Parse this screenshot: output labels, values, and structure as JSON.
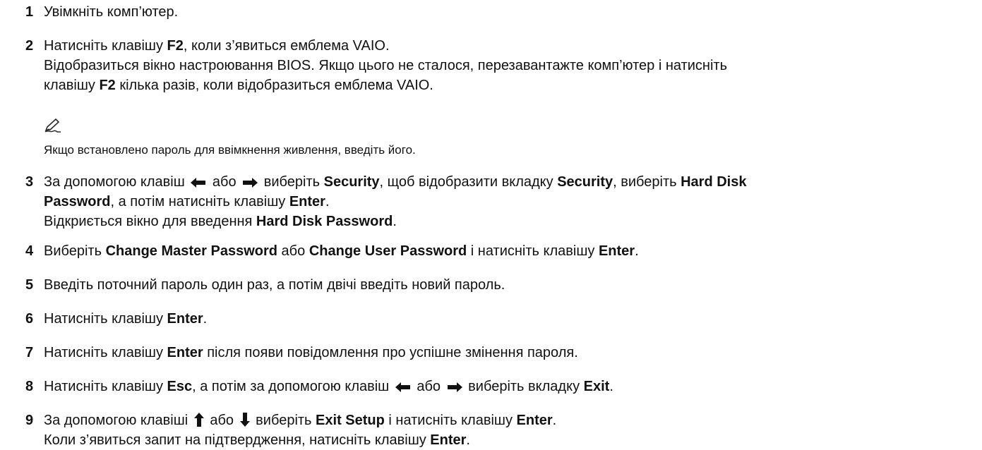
{
  "steps": [
    {
      "num": "1",
      "lines": [
        {
          "t": "Увімкніть комп’ютер."
        }
      ]
    },
    {
      "num": "2",
      "lines": [
        {
          "pre": "Натисніть клавішу ",
          "b1": "F2",
          "post": ", коли з’явиться емблема VAIO."
        },
        {
          "t": "Відобразиться вікно настроювання BIOS. Якщо цього не сталося, перезавантажте комп’ютер і натисніть"
        },
        {
          "pre": "клавішу ",
          "b1": "F2",
          "post": " кілька разів, коли відобразиться емблема VAIO."
        }
      ]
    },
    {
      "num": "3",
      "line1": {
        "pre": "За допомогою клавіш ",
        "mid1": " або ",
        "mid2": " виберіть ",
        "b1": "Security",
        "mid3": ", щоб відобразити вкладку ",
        "b2": "Security",
        "mid4": ", виберіть ",
        "b3": "Hard Disk"
      },
      "line2": {
        "b1": "Password",
        "mid": ", а потім натисніть клавішу ",
        "b2": "Enter",
        "post": "."
      },
      "line3": {
        "pre": "Відкриється вікно для введення ",
        "b1": "Hard Disk Password",
        "post": "."
      }
    },
    {
      "num": "4",
      "line1": {
        "pre": "Виберіть ",
        "b1": "Change Master Password",
        "mid": " або ",
        "b2": "Change User Password",
        "mid2": " і натисніть клавішу ",
        "b3": "Enter",
        "post": "."
      }
    },
    {
      "num": "5",
      "lines": [
        {
          "t": "Введіть поточний пароль один раз, а потім двічі введіть новий пароль."
        }
      ]
    },
    {
      "num": "6",
      "line1": {
        "pre": "Натисніть клавішу ",
        "b1": "Enter",
        "post": "."
      }
    },
    {
      "num": "7",
      "line1": {
        "pre": "Натисніть клавішу ",
        "b1": "Enter",
        "post": " після появи повідомлення про успішне змінення пароля."
      }
    },
    {
      "num": "8",
      "line1": {
        "pre": "Натисніть клавішу ",
        "b1": "Esc",
        "mid": ", а потім за допомогою клавіш ",
        "mid2": " або ",
        "mid3": " виберіть вкладку ",
        "b2": "Exit",
        "post": "."
      }
    },
    {
      "num": "9",
      "line1": {
        "pre": "За допомогою клавіші ",
        "mid": " або ",
        "mid2": " виберіть ",
        "b1": "Exit Setup",
        "mid3": " і натисніть клавішу ",
        "b2": "Enter",
        "post": "."
      },
      "line2": {
        "pre": "Коли з’явиться запит на підтвердження, натисніть клавішу ",
        "b1": "Enter",
        "post": "."
      }
    }
  ],
  "note": {
    "icon": "note-pen-icon",
    "text": "Якщо встановлено пароль для ввімкнення живлення, введіть його."
  },
  "icons": {
    "arrow_left": "arrow-left-icon",
    "arrow_right": "arrow-right-icon",
    "arrow_up": "arrow-up-icon",
    "arrow_down": "arrow-down-icon"
  }
}
